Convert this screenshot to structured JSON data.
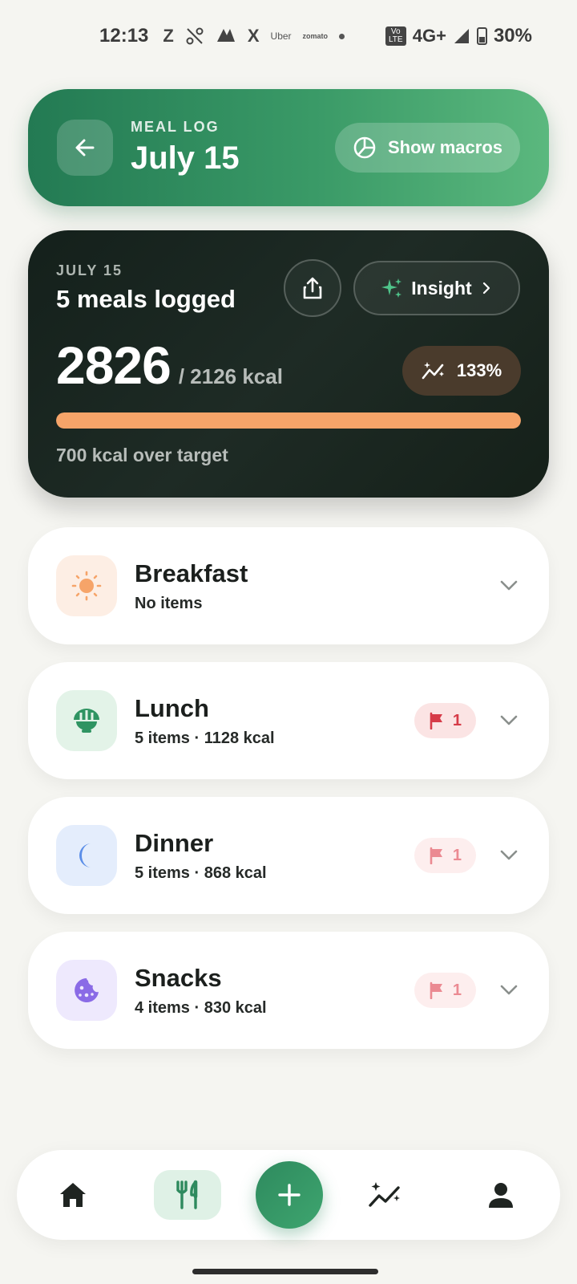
{
  "status_bar": {
    "time": "12:13",
    "app_icons": [
      "Z",
      "⚬",
      "⚙",
      "X"
    ],
    "uber": "Uber",
    "zomato": "zomato",
    "volte": "Vo LTE",
    "network": "4G+",
    "battery": "30%"
  },
  "header": {
    "kicker": "MEAL LOG",
    "title": "July 15",
    "macros_label": "Show macros"
  },
  "summary": {
    "date": "JULY 15",
    "meals_logged": "5 meals logged",
    "insight_label": "Insight",
    "kcal_consumed": "2826",
    "kcal_target_text": "/ 2126 kcal",
    "percent_label": "133%",
    "progress_fraction": 1.0,
    "over_text": "700 kcal over target",
    "colors": {
      "progress": "#f6a469",
      "card": "#1a2620"
    }
  },
  "meals": [
    {
      "name": "Breakfast",
      "sub": "No items",
      "icon": "sun-icon",
      "flag": null
    },
    {
      "name": "Lunch",
      "sub": "5 items · 1128 kcal",
      "icon": "bowl-icon",
      "flag": "1"
    },
    {
      "name": "Dinner",
      "sub": "5 items · 868 kcal",
      "icon": "moon-icon",
      "flag": "1"
    },
    {
      "name": "Snacks",
      "sub": "4 items · 830 kcal",
      "icon": "cookie-icon",
      "flag": "1"
    }
  ],
  "nav": {
    "items": [
      "home-icon",
      "fork-knife-icon",
      "plus-icon",
      "trends-icon",
      "profile-icon"
    ],
    "active": "fork-knife-icon",
    "accent": "#2e8a5e"
  }
}
